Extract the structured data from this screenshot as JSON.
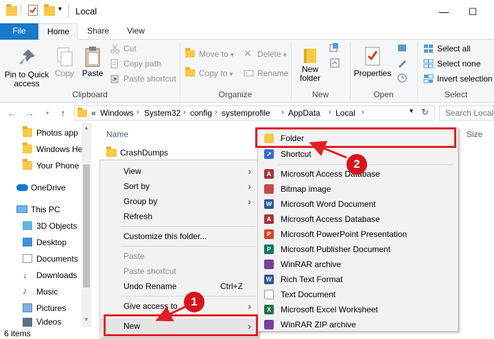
{
  "window": {
    "title": "Local",
    "minimize": "—",
    "maximize": "☐"
  },
  "tabs": [
    "File",
    "Home",
    "Share",
    "View"
  ],
  "ribbon": {
    "clipboard": {
      "label": "Clipboard",
      "pin_to_quick_access": "Pin to Quick access",
      "copy": "Copy",
      "paste": "Paste",
      "cut": "Cut",
      "copy_path": "Copy path",
      "paste_shortcut": "Paste shortcut"
    },
    "organize": {
      "label": "Organize",
      "move_to": "Move to",
      "copy_to": "Copy to",
      "delete": "Delete",
      "rename": "Rename"
    },
    "new": {
      "label": "New",
      "new_folder": "New folder"
    },
    "open": {
      "label": "Open",
      "properties": "Properties"
    },
    "select": {
      "label": "Select",
      "select_all": "Select all",
      "select_none": "Select none",
      "invert_selection": "Invert selection"
    }
  },
  "address": {
    "overflow": "«",
    "crumbs": [
      "Windows",
      "System32",
      "config",
      "systemprofile",
      "AppData",
      "Local"
    ],
    "search_placeholder": "Search Local"
  },
  "nav": {
    "items": [
      "Photos app",
      "Windows He",
      "Your Phone",
      "OneDrive",
      "This PC",
      "3D Objects",
      "Desktop",
      "Documents",
      "Downloads",
      "Music",
      "Pictures",
      "Videos"
    ]
  },
  "filelist": {
    "col_name": "Name",
    "col_size": "Size",
    "files": [
      "CrashDumps"
    ]
  },
  "status": {
    "items": "6 items"
  },
  "context_menu": {
    "view": "View",
    "sort_by": "Sort by",
    "group_by": "Group by",
    "refresh": "Refresh",
    "customize": "Customize this folder...",
    "paste": "Paste",
    "paste_shortcut": "Paste shortcut",
    "undo_rename": "Undo Rename",
    "undo_shortcut": "Ctrl+Z",
    "give_access": "Give access to",
    "new": "New"
  },
  "new_submenu": {
    "items": [
      {
        "label": "Folder",
        "icon": "folder-icon",
        "color": "#f7c948"
      },
      {
        "label": "Shortcut",
        "icon": "shortcut-icon",
        "color": "#2f6fd0"
      },
      {
        "label": "Microsoft Access Database",
        "icon": "access-icon",
        "color": "#a4373a"
      },
      {
        "label": "Bitmap image",
        "icon": "bitmap-icon",
        "color": "#c94a4a"
      },
      {
        "label": "Microsoft Word Document",
        "icon": "word-icon",
        "color": "#2b579a"
      },
      {
        "label": "Microsoft Access Database",
        "icon": "access-icon",
        "color": "#a4373a"
      },
      {
        "label": "Microsoft PowerPoint Presentation",
        "icon": "powerpoint-icon",
        "color": "#d24726"
      },
      {
        "label": "Microsoft Publisher Document",
        "icon": "publisher-icon",
        "color": "#077568"
      },
      {
        "label": "WinRAR archive",
        "icon": "winrar-icon",
        "color": "#7b3f98"
      },
      {
        "label": "Rich Text Format",
        "icon": "rtf-icon",
        "color": "#2b579a"
      },
      {
        "label": "Text Document",
        "icon": "text-document-icon",
        "color": "#ffffff"
      },
      {
        "label": "Microsoft Excel Worksheet",
        "icon": "excel-icon",
        "color": "#217346"
      },
      {
        "label": "WinRAR ZIP archive",
        "icon": "winrar-zip-icon",
        "color": "#7b3f98"
      }
    ]
  },
  "annotations": {
    "step1": "1",
    "step2": "2",
    "accent": "#e01f26"
  }
}
